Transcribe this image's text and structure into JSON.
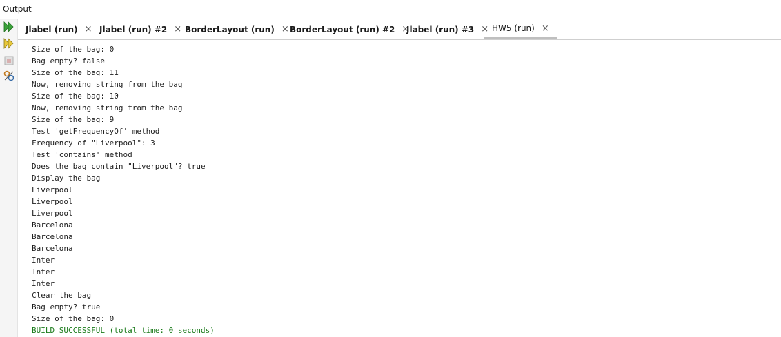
{
  "window": {
    "title": "Output"
  },
  "tabs": [
    {
      "label": "Jlabel (run)",
      "active": false
    },
    {
      "label": "Jlabel (run) #2",
      "active": false
    },
    {
      "label": "BorderLayout (run)",
      "active": false
    },
    {
      "label": "BorderLayout (run) #2",
      "active": false
    },
    {
      "label": "Jlabel (run) #3",
      "active": false
    },
    {
      "label": "HW5 (run)",
      "active": true
    }
  ],
  "tab_close_glyph": "×",
  "toolbar": {
    "icons": [
      "rerun-icon",
      "rerun-with-options-icon",
      "stop-icon",
      "settings-icon"
    ],
    "colors": {
      "rerun": "#3aa23a",
      "stop": "#c8c8c8"
    }
  },
  "console": {
    "lines": [
      "Size of the bag: 0",
      "Bag empty? false",
      "Size of the bag: 11",
      "Now, removing string from the bag",
      "Size of the bag: 10",
      "Now, removing string from the bag",
      "Size of the bag: 9",
      "Test 'getFrequencyOf' method",
      "Frequency of \"Liverpool\": 3",
      "Test 'contains' method",
      "Does the bag contain \"Liverpool\"? true",
      "Display the bag",
      "Liverpool",
      "Liverpool",
      "Liverpool",
      "Barcelona",
      "Barcelona",
      "Barcelona",
      "Inter",
      "Inter",
      "Inter",
      "Clear the bag",
      "Bag empty? true",
      "Size of the bag: 0"
    ],
    "build_status": "BUILD SUCCESSFUL (total time: 0 seconds)",
    "build_status_color": "#1a7a1a"
  }
}
